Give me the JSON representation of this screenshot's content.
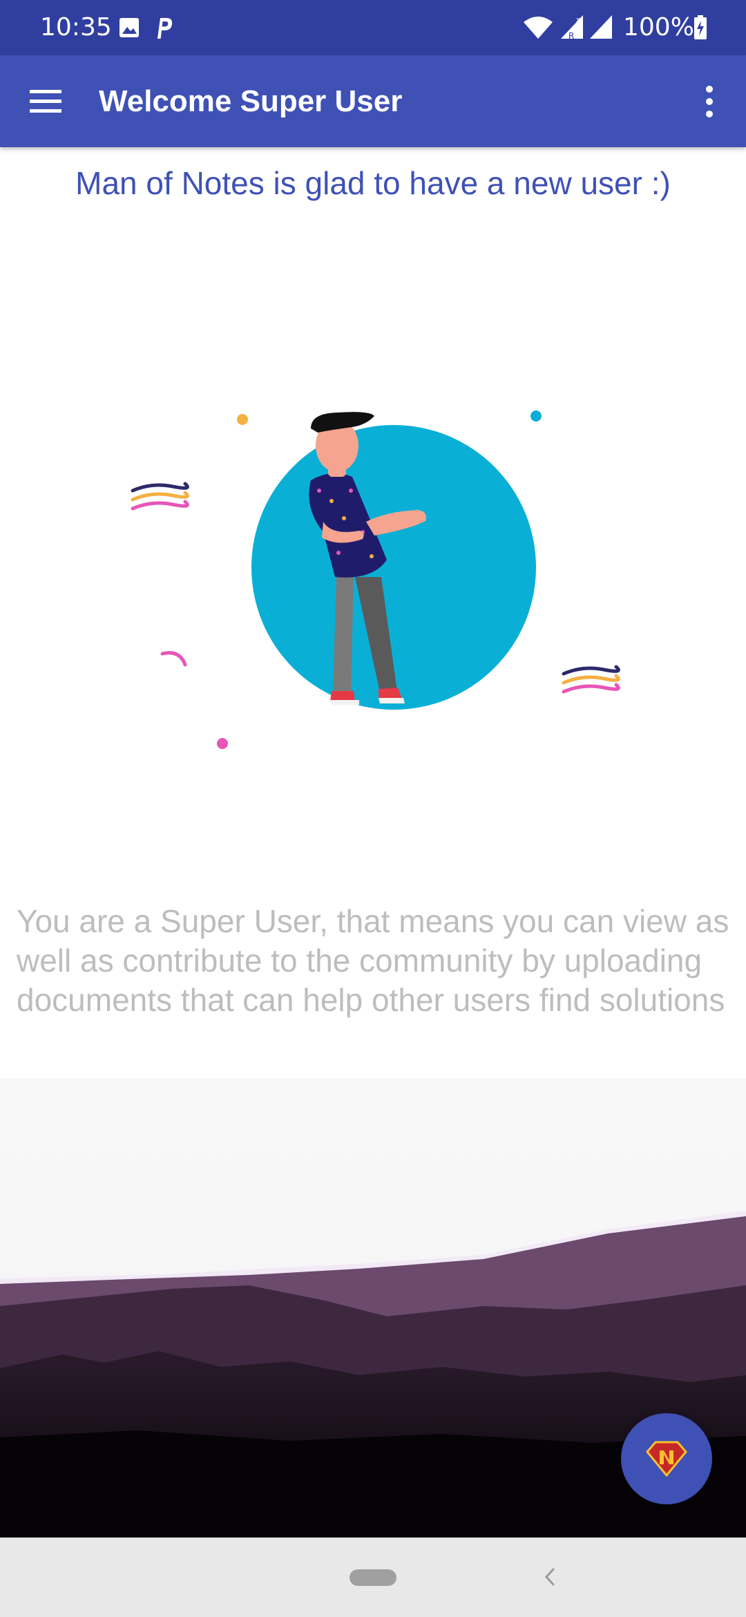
{
  "status_bar": {
    "time": "10:35",
    "battery": "100%",
    "icons": [
      "image-icon",
      "parking-app-icon",
      "wifi-icon",
      "signal-roaming-icon",
      "signal-icon",
      "battery-charging-icon"
    ]
  },
  "app_bar": {
    "title": "Welcome Super User",
    "menu_icon": "hamburger-menu-icon",
    "overflow_icon": "more-vert-icon"
  },
  "content": {
    "welcome": "Man of Notes is glad to have a new user :)",
    "description": "You are a Super User, that means you can view as well as contribute to the community by uploading documents that can help other users find solutions"
  },
  "fab": {
    "icon": "superman-n-logo-icon"
  },
  "nav": {
    "home": "home-pill",
    "back": "back-chevron-icon"
  },
  "colors": {
    "status_bar": "#303f9f",
    "app_bar": "#3f51b5",
    "accent_text": "#3f51b5",
    "muted_text": "#bdbdbd",
    "illustration_circle": "#0aafd6"
  }
}
